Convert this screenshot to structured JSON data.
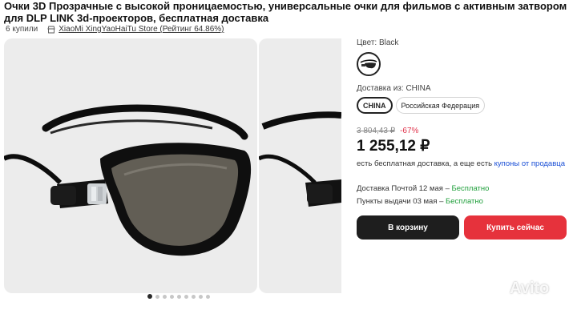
{
  "product": {
    "title": "Очки 3D Прозрачные с высокой проницаемостью, универсальные очки для фильмов с активным затвором для DLP LINK 3d-проекторов, бесплатная доставка",
    "purchases": "6 купили",
    "store": "XiaoMi XingYaoHaiTu Store (Рейтинг 64.86%)"
  },
  "gallery": {
    "image_alt": "3D glasses",
    "dots_count": 9,
    "active_dot": 0
  },
  "options": {
    "color_label": "Цвет: Black",
    "ship_from_label": "Доставка из: CHINA",
    "ship_from": [
      "CHINA",
      "Российская Федерация"
    ],
    "ship_from_selected": "CHINA"
  },
  "pricing": {
    "old_price": "3 804,43 ₽",
    "discount": "-67%",
    "price": "1 255,12 ₽",
    "note_text": "есть бесплатная доставка, а еще есть ",
    "note_link": "купоны от продавца"
  },
  "delivery": {
    "post_text": "Доставка Почтой 12 мая – ",
    "post_value": "Бесплатно",
    "pickup_text": "Пункты выдачи 03 мая – ",
    "pickup_value": "Бесплатно"
  },
  "actions": {
    "cart": "В корзину",
    "buy": "Купить сейчас"
  },
  "watermark": "Avito",
  "colors": {
    "accent_red": "#e6323c",
    "discount_red": "#e0334b",
    "free_green": "#1f9f3b",
    "link_blue": "#1a4fd6",
    "dark_button": "#1e1e1e"
  }
}
